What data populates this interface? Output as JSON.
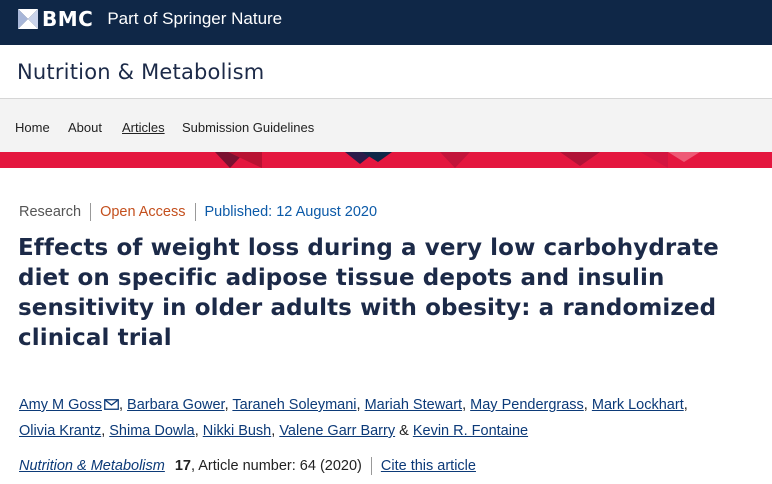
{
  "header": {
    "logo_text": "BMC",
    "logo_sub": "Part of Springer Nature"
  },
  "journal": {
    "title": "Nutrition & Metabolism"
  },
  "nav": {
    "items": [
      {
        "label": "Home"
      },
      {
        "label": "About"
      },
      {
        "label": "Articles"
      },
      {
        "label": "Submission Guidelines"
      }
    ]
  },
  "article": {
    "type": "Research",
    "access": "Open Access",
    "published": "Published: 12 August 2020",
    "title": "Effects of weight loss during a very low carbohydrate diet on specific adipose tissue depots and insulin sensitivity in older adults with obesity: a randomized clinical trial",
    "authors": [
      "Amy M Goss",
      "Barbara Gower",
      "Taraneh Soleymani",
      "Mariah Stewart",
      "May Pendergrass",
      "Mark Lockhart",
      "Olivia Krantz",
      "Shima Dowla",
      "Nikki Bush",
      "Valene Garr Barry",
      "Kevin R. Fontaine"
    ],
    "citation": {
      "journal": "Nutrition & Metabolism",
      "volume": "17",
      "article_info": ", Article number: 64 (2020)",
      "cite_label": "Cite this article"
    }
  },
  "colors": {
    "topbar": "#0f2747",
    "accent_red": "#e4173f",
    "link": "#0c3a78",
    "open_access": "#c4501e"
  }
}
